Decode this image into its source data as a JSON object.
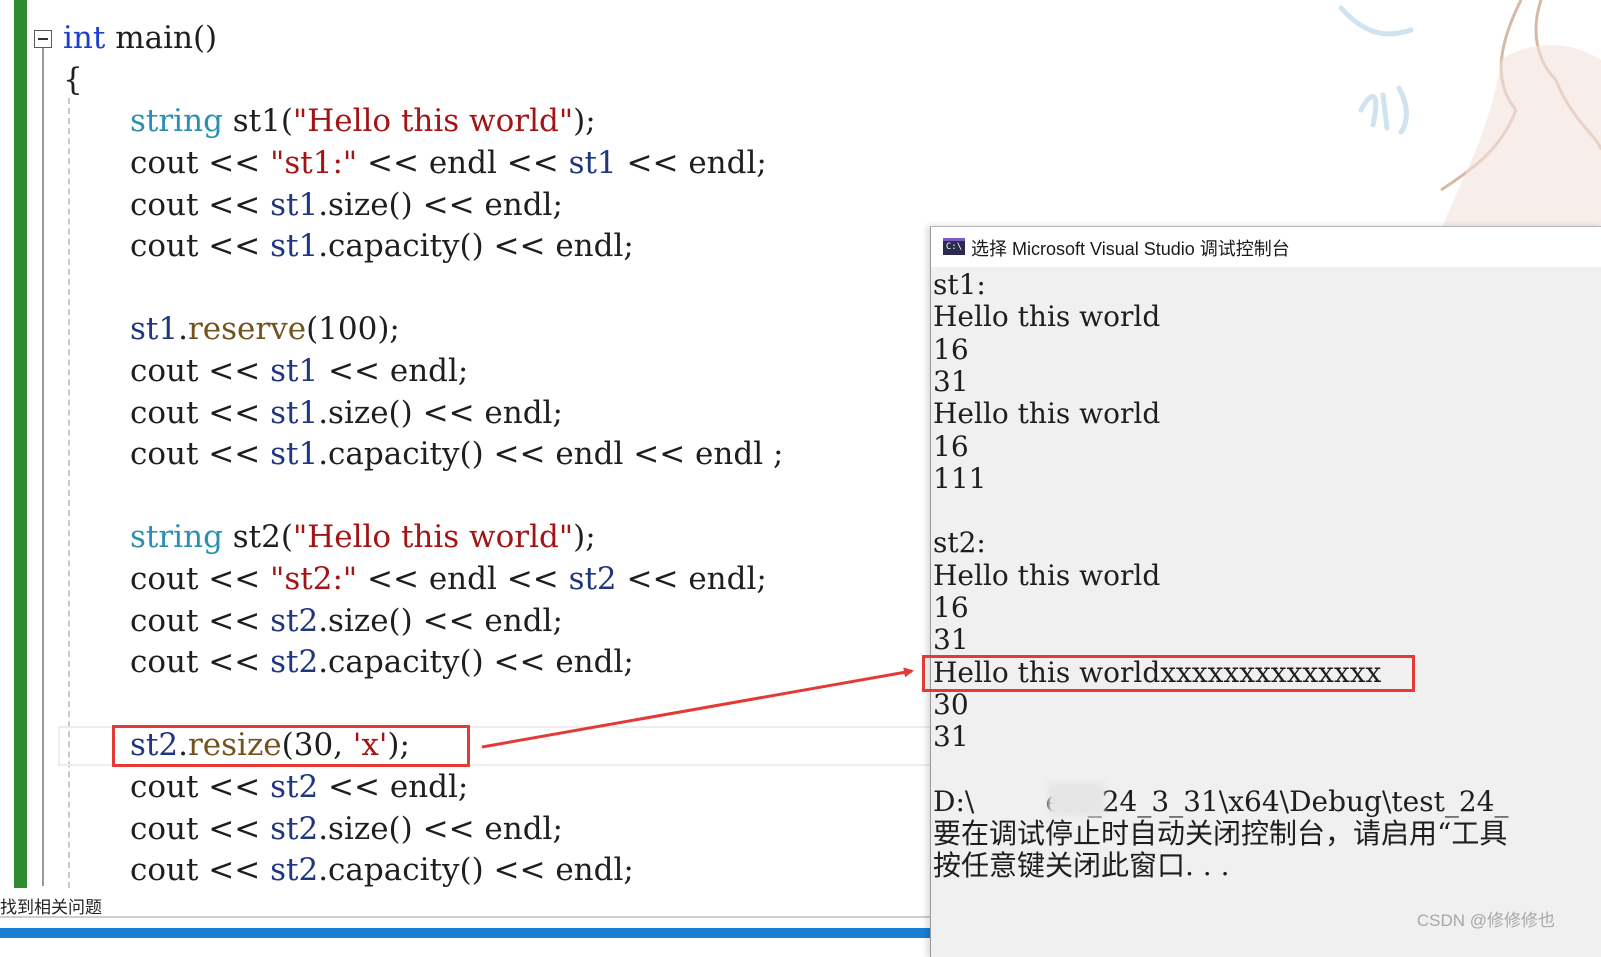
{
  "editor": {
    "lines": [
      [
        {
          "t": "int",
          "c": "kw"
        },
        {
          "t": " main()",
          "c": ""
        }
      ],
      [
        {
          "t": "{",
          "c": ""
        }
      ],
      [],
      [
        {
          "t": "string",
          "c": "ty"
        },
        {
          "t": " st1(",
          "c": ""
        },
        {
          "t": "\"Hello this world\"",
          "c": "st"
        },
        {
          "t": ");",
          "c": ""
        }
      ],
      [
        {
          "t": "cout << ",
          "c": ""
        },
        {
          "t": "\"st1:\"",
          "c": "st"
        },
        {
          "t": " << endl << ",
          "c": ""
        },
        {
          "t": "st1",
          "c": "vr"
        },
        {
          "t": " << endl;",
          "c": ""
        }
      ],
      [
        {
          "t": "cout << ",
          "c": ""
        },
        {
          "t": "st1",
          "c": "vr"
        },
        {
          "t": ".size() << endl;",
          "c": ""
        }
      ],
      [
        {
          "t": "cout << ",
          "c": ""
        },
        {
          "t": "st1",
          "c": "vr"
        },
        {
          "t": ".capacity() << endl;",
          "c": ""
        }
      ],
      [],
      [
        {
          "t": "st1",
          "c": "vr"
        },
        {
          "t": ".",
          "c": ""
        },
        {
          "t": "reserve",
          "c": "fn"
        },
        {
          "t": "(100);",
          "c": ""
        }
      ],
      [
        {
          "t": "cout << ",
          "c": ""
        },
        {
          "t": "st1",
          "c": "vr"
        },
        {
          "t": " << endl;",
          "c": ""
        }
      ],
      [
        {
          "t": "cout << ",
          "c": ""
        },
        {
          "t": "st1",
          "c": "vr"
        },
        {
          "t": ".size() << endl;",
          "c": ""
        }
      ],
      [
        {
          "t": "cout << ",
          "c": ""
        },
        {
          "t": "st1",
          "c": "vr"
        },
        {
          "t": ".capacity() << endl << endl ;",
          "c": ""
        }
      ],
      [],
      [
        {
          "t": "string",
          "c": "ty"
        },
        {
          "t": " st2(",
          "c": ""
        },
        {
          "t": "\"Hello this world\"",
          "c": "st"
        },
        {
          "t": ");",
          "c": ""
        }
      ],
      [
        {
          "t": "cout << ",
          "c": ""
        },
        {
          "t": "\"st2:\"",
          "c": "st"
        },
        {
          "t": " << endl << ",
          "c": ""
        },
        {
          "t": "st2",
          "c": "vr"
        },
        {
          "t": " << endl;",
          "c": ""
        }
      ],
      [
        {
          "t": "cout << ",
          "c": ""
        },
        {
          "t": "st2",
          "c": "vr"
        },
        {
          "t": ".size() << endl;",
          "c": ""
        }
      ],
      [
        {
          "t": "cout << ",
          "c": ""
        },
        {
          "t": "st2",
          "c": "vr"
        },
        {
          "t": ".capacity() << endl;",
          "c": ""
        }
      ],
      [],
      [
        {
          "t": "st2",
          "c": "vr"
        },
        {
          "t": ".",
          "c": ""
        },
        {
          "t": "resize",
          "c": "fn"
        },
        {
          "t": "(30, ",
          "c": ""
        },
        {
          "t": "'x'",
          "c": "st"
        },
        {
          "t": ");",
          "c": ""
        }
      ],
      [
        {
          "t": "cout << ",
          "c": ""
        },
        {
          "t": "st2",
          "c": "vr"
        },
        {
          "t": " << endl;",
          "c": ""
        }
      ],
      [
        {
          "t": "cout << ",
          "c": ""
        },
        {
          "t": "st2",
          "c": "vr"
        },
        {
          "t": ".size() << endl;",
          "c": ""
        }
      ],
      [
        {
          "t": "cout << ",
          "c": ""
        },
        {
          "t": "st2",
          "c": "vr"
        },
        {
          "t": ".capacity() << endl;",
          "c": ""
        }
      ]
    ],
    "status_text": "找到相关问题"
  },
  "console": {
    "title": "选择 Microsoft Visual Studio 调试控制台",
    "icon_label": "C:\\",
    "lines": [
      "st1:",
      "Hello this world",
      "16",
      "31",
      "Hello this world",
      "16",
      "111",
      "",
      "st2:",
      "Hello this world",
      "16",
      "31",
      "Hello this worldxxxxxxxxxxxxxx",
      "30",
      "31",
      "",
      "D:\\        est_24_3_31\\x64\\Debug\\test_24_",
      "要在调试停止时自动关闭控制台，请启用“工具",
      "按任意键关闭此窗口. . ."
    ]
  },
  "watermark": "CSDN @修修修也",
  "colors": {
    "keyword": "#1c3fd0",
    "type": "#2c8fb0",
    "string": "#a31515",
    "variable": "#1f377f",
    "function": "#74531f",
    "highlight_box": "#e53935",
    "change_bar": "#2e8b2e"
  }
}
